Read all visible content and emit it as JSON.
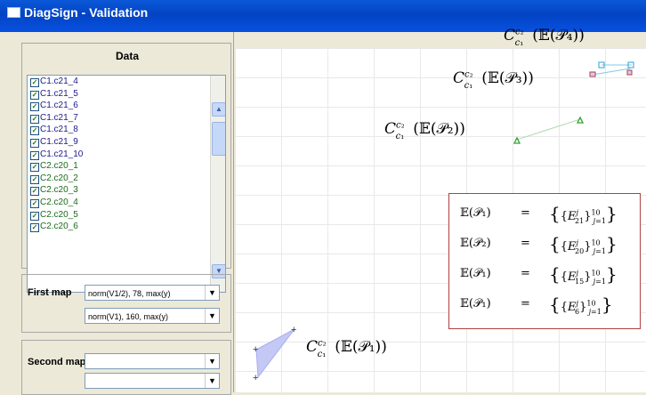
{
  "window": {
    "title": "DiagSign - Validation"
  },
  "data_panel": {
    "title": "Data",
    "items": [
      {
        "label": "C1.c21_4",
        "checked": true,
        "color": "#1a1a8a"
      },
      {
        "label": "C1.c21_5",
        "checked": true,
        "color": "#1a1a8a"
      },
      {
        "label": "C1.c21_6",
        "checked": true,
        "color": "#1a1a8a"
      },
      {
        "label": "C1.c21_7",
        "checked": true,
        "color": "#1a1a8a"
      },
      {
        "label": "C1.c21_8",
        "checked": true,
        "color": "#1a1a8a"
      },
      {
        "label": "C1.c21_9",
        "checked": true,
        "color": "#1a1a8a"
      },
      {
        "label": "C1.c21_10",
        "checked": true,
        "color": "#1a1a8a"
      },
      {
        "label": "C2.c20_1",
        "checked": true,
        "color": "#1a6a1a"
      },
      {
        "label": "C2.c20_2",
        "checked": true,
        "color": "#1a6a1a"
      },
      {
        "label": "C2.c20_3",
        "checked": true,
        "color": "#1a6a1a"
      },
      {
        "label": "C2.c20_4",
        "checked": true,
        "color": "#1a6a1a"
      },
      {
        "label": "C2.c20_5",
        "checked": true,
        "color": "#1a6a1a"
      },
      {
        "label": "C2.c20_6",
        "checked": true,
        "color": "#1a6a1a"
      }
    ]
  },
  "first_map": {
    "label": "First map",
    "combo1": "norm(V1/2), 78, max(y)",
    "combo2": "norm(V1), 160, max(y)"
  },
  "second_map": {
    "label": "Second map",
    "combo1": "",
    "combo2": ""
  },
  "canvas": {
    "labels": {
      "p4": "C_{c1}^{c2}(𝔼(𝒫₄))",
      "p3": "C_{c1}^{c2}(𝔼(𝒫₃))",
      "p2": "C_{c1}^{c2}(𝔼(𝒫₂))",
      "p1": "C_{c1}^{c2}(𝔼(𝒫₁))"
    },
    "equations": [
      {
        "lhs": "𝔼(𝒫₁)",
        "eq": "=",
        "rhs": "{ {E21j} j=1 10 }",
        "sub": "21"
      },
      {
        "lhs": "𝔼(𝒫₂)",
        "eq": "=",
        "rhs": "{ {E20j} j=1 10 }",
        "sub": "20"
      },
      {
        "lhs": "𝔼(𝒫₁)",
        "eq": "=",
        "rhs": "{ {E15j} j=1 10 }",
        "sub": "15"
      },
      {
        "lhs": "𝔼(𝒫₁)",
        "eq": "=",
        "rhs": "{ {E6j} j=1 10 }",
        "sub": "6"
      }
    ]
  },
  "icons": {
    "check": "checkmark-icon",
    "up": "scroll-up-arrow-icon",
    "down": "scroll-down-arrow-icon",
    "dropdown": "dropdown-arrow-icon"
  },
  "colors": {
    "titlebar": "#0750e0",
    "p1_fill": "#c4c8f4",
    "p2_line": "#30a030",
    "p3_p4": "#40a8d0",
    "eq_border": "#b04040"
  }
}
